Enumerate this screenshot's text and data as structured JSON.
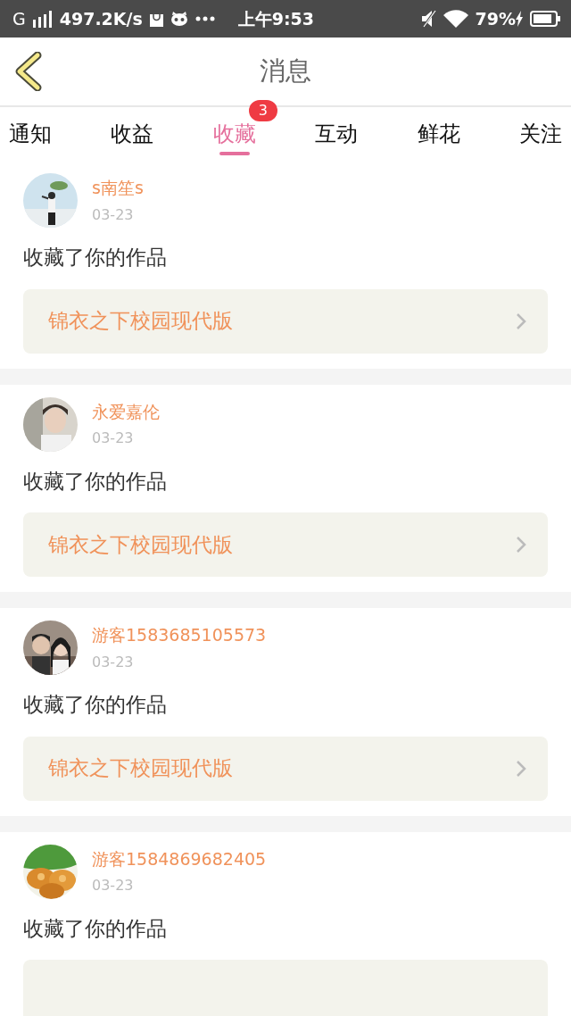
{
  "status_bar": {
    "network": "G",
    "speed": "497.2K/s",
    "time": "上午9:53",
    "battery": "79%"
  },
  "header": {
    "title": "消息"
  },
  "tabs": [
    {
      "label": "通知",
      "selected": false
    },
    {
      "label": "收益",
      "selected": false
    },
    {
      "label": "收藏",
      "selected": true,
      "badge": "3"
    },
    {
      "label": "互动",
      "selected": false
    },
    {
      "label": "鲜花",
      "selected": false
    },
    {
      "label": "关注",
      "selected": false
    }
  ],
  "messages": [
    {
      "user": "s南笙s",
      "date": "03-23",
      "action": "收藏了你的作品",
      "work": "锦衣之下校园现代版"
    },
    {
      "user": "永爱嘉伦",
      "date": "03-23",
      "action": "收藏了你的作品",
      "work": "锦衣之下校园现代版"
    },
    {
      "user": "游客1583685105573",
      "date": "03-23",
      "action": "收藏了你的作品",
      "work": "锦衣之下校园现代版"
    },
    {
      "user": "游客1584869682405",
      "date": "03-23",
      "action": "收藏了你的作品"
    }
  ]
}
